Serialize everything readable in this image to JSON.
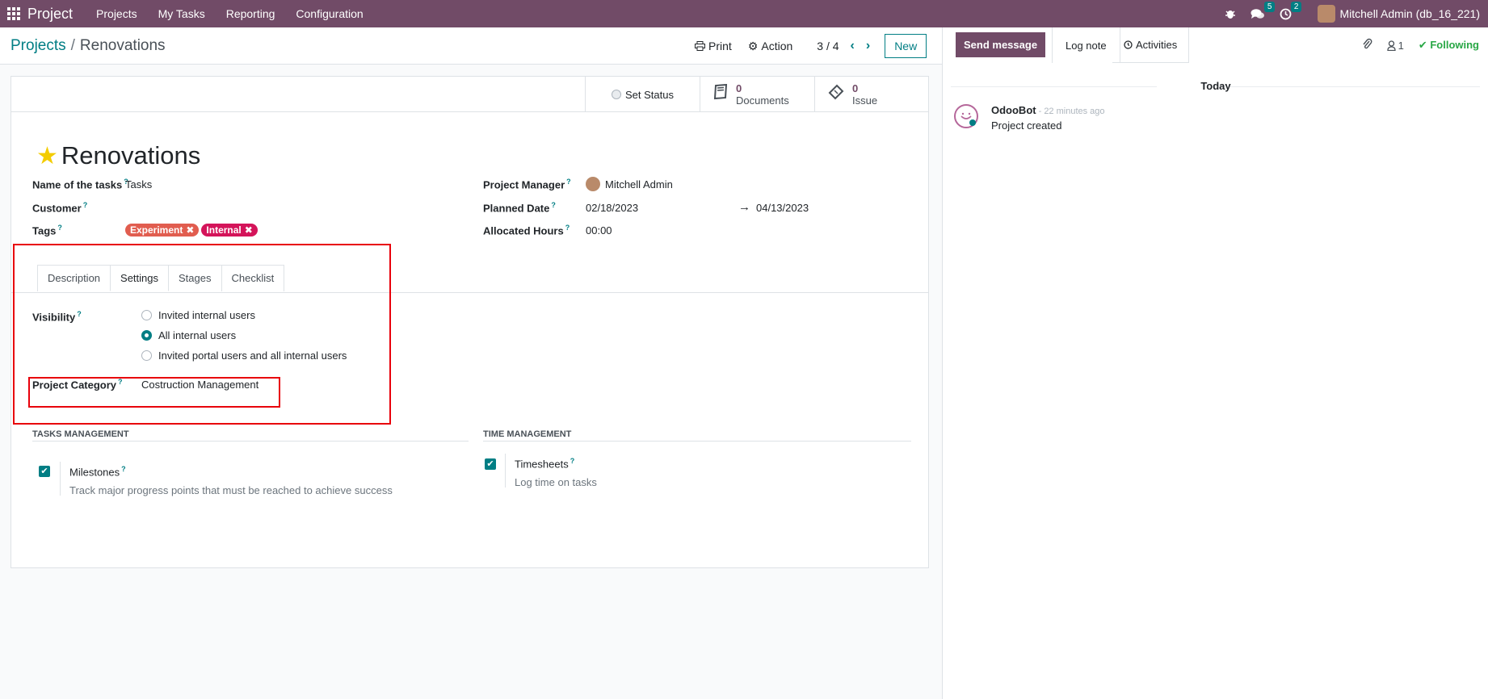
{
  "navbar": {
    "app_name": "Project",
    "menu": [
      "Projects",
      "My Tasks",
      "Reporting",
      "Configuration"
    ],
    "messages_count": "5",
    "activities_count": "2",
    "user": "Mitchell Admin (db_16_221)"
  },
  "control_panel": {
    "breadcrumb_parent": "Projects",
    "breadcrumb_sep": "/",
    "breadcrumb_current": "Renovations",
    "print_label": "Print",
    "action_label": "Action",
    "pager": "3 / 4",
    "new_label": "New"
  },
  "statusbar": {
    "set_status": "Set Status",
    "documents_count": "0",
    "documents_label": "Documents",
    "issue_count": "0",
    "issue_label": "Issue"
  },
  "form": {
    "title": "Renovations",
    "name_of_tasks_label": "Name of the tasks",
    "name_of_tasks_value": "Tasks",
    "customer_label": "Customer",
    "tags_label": "Tags",
    "tags": [
      {
        "label": "Experiment",
        "color": "#e15d4f"
      },
      {
        "label": "Internal",
        "color": "#d4145a"
      }
    ],
    "project_manager_label": "Project Manager",
    "project_manager_value": "Mitchell Admin",
    "planned_date_label": "Planned Date",
    "planned_date_start": "02/18/2023",
    "planned_date_end": "04/13/2023",
    "allocated_hours_label": "Allocated Hours",
    "allocated_hours_value": "00:00",
    "help_mark": "?"
  },
  "tabs": [
    "Description",
    "Settings",
    "Stages",
    "Checklist"
  ],
  "settings": {
    "visibility_label": "Visibility",
    "visibility_options": [
      "Invited internal users",
      "All internal users",
      "Invited portal users and all internal users"
    ],
    "visibility_selected": "All internal users",
    "project_category_label": "Project Category",
    "project_category_value": "Costruction Management",
    "tasks_management_header": "Tasks Management",
    "time_management_header": "Time Management",
    "milestones_title": "Milestones",
    "milestones_desc": "Track major progress points that must be reached to achieve success",
    "timesheets_title": "Timesheets",
    "timesheets_desc": "Log time on tasks"
  },
  "chatter": {
    "send_message": "Send message",
    "log_note": "Log note",
    "activities": "Activities",
    "followers_count": "1",
    "following": "Following",
    "today": "Today",
    "author": "OdooBot",
    "time": "- 22 minutes ago",
    "body": "Project created"
  },
  "colors": {
    "brand": "#714b67",
    "accent": "#017e84",
    "highlight_box": "#e8000b"
  }
}
